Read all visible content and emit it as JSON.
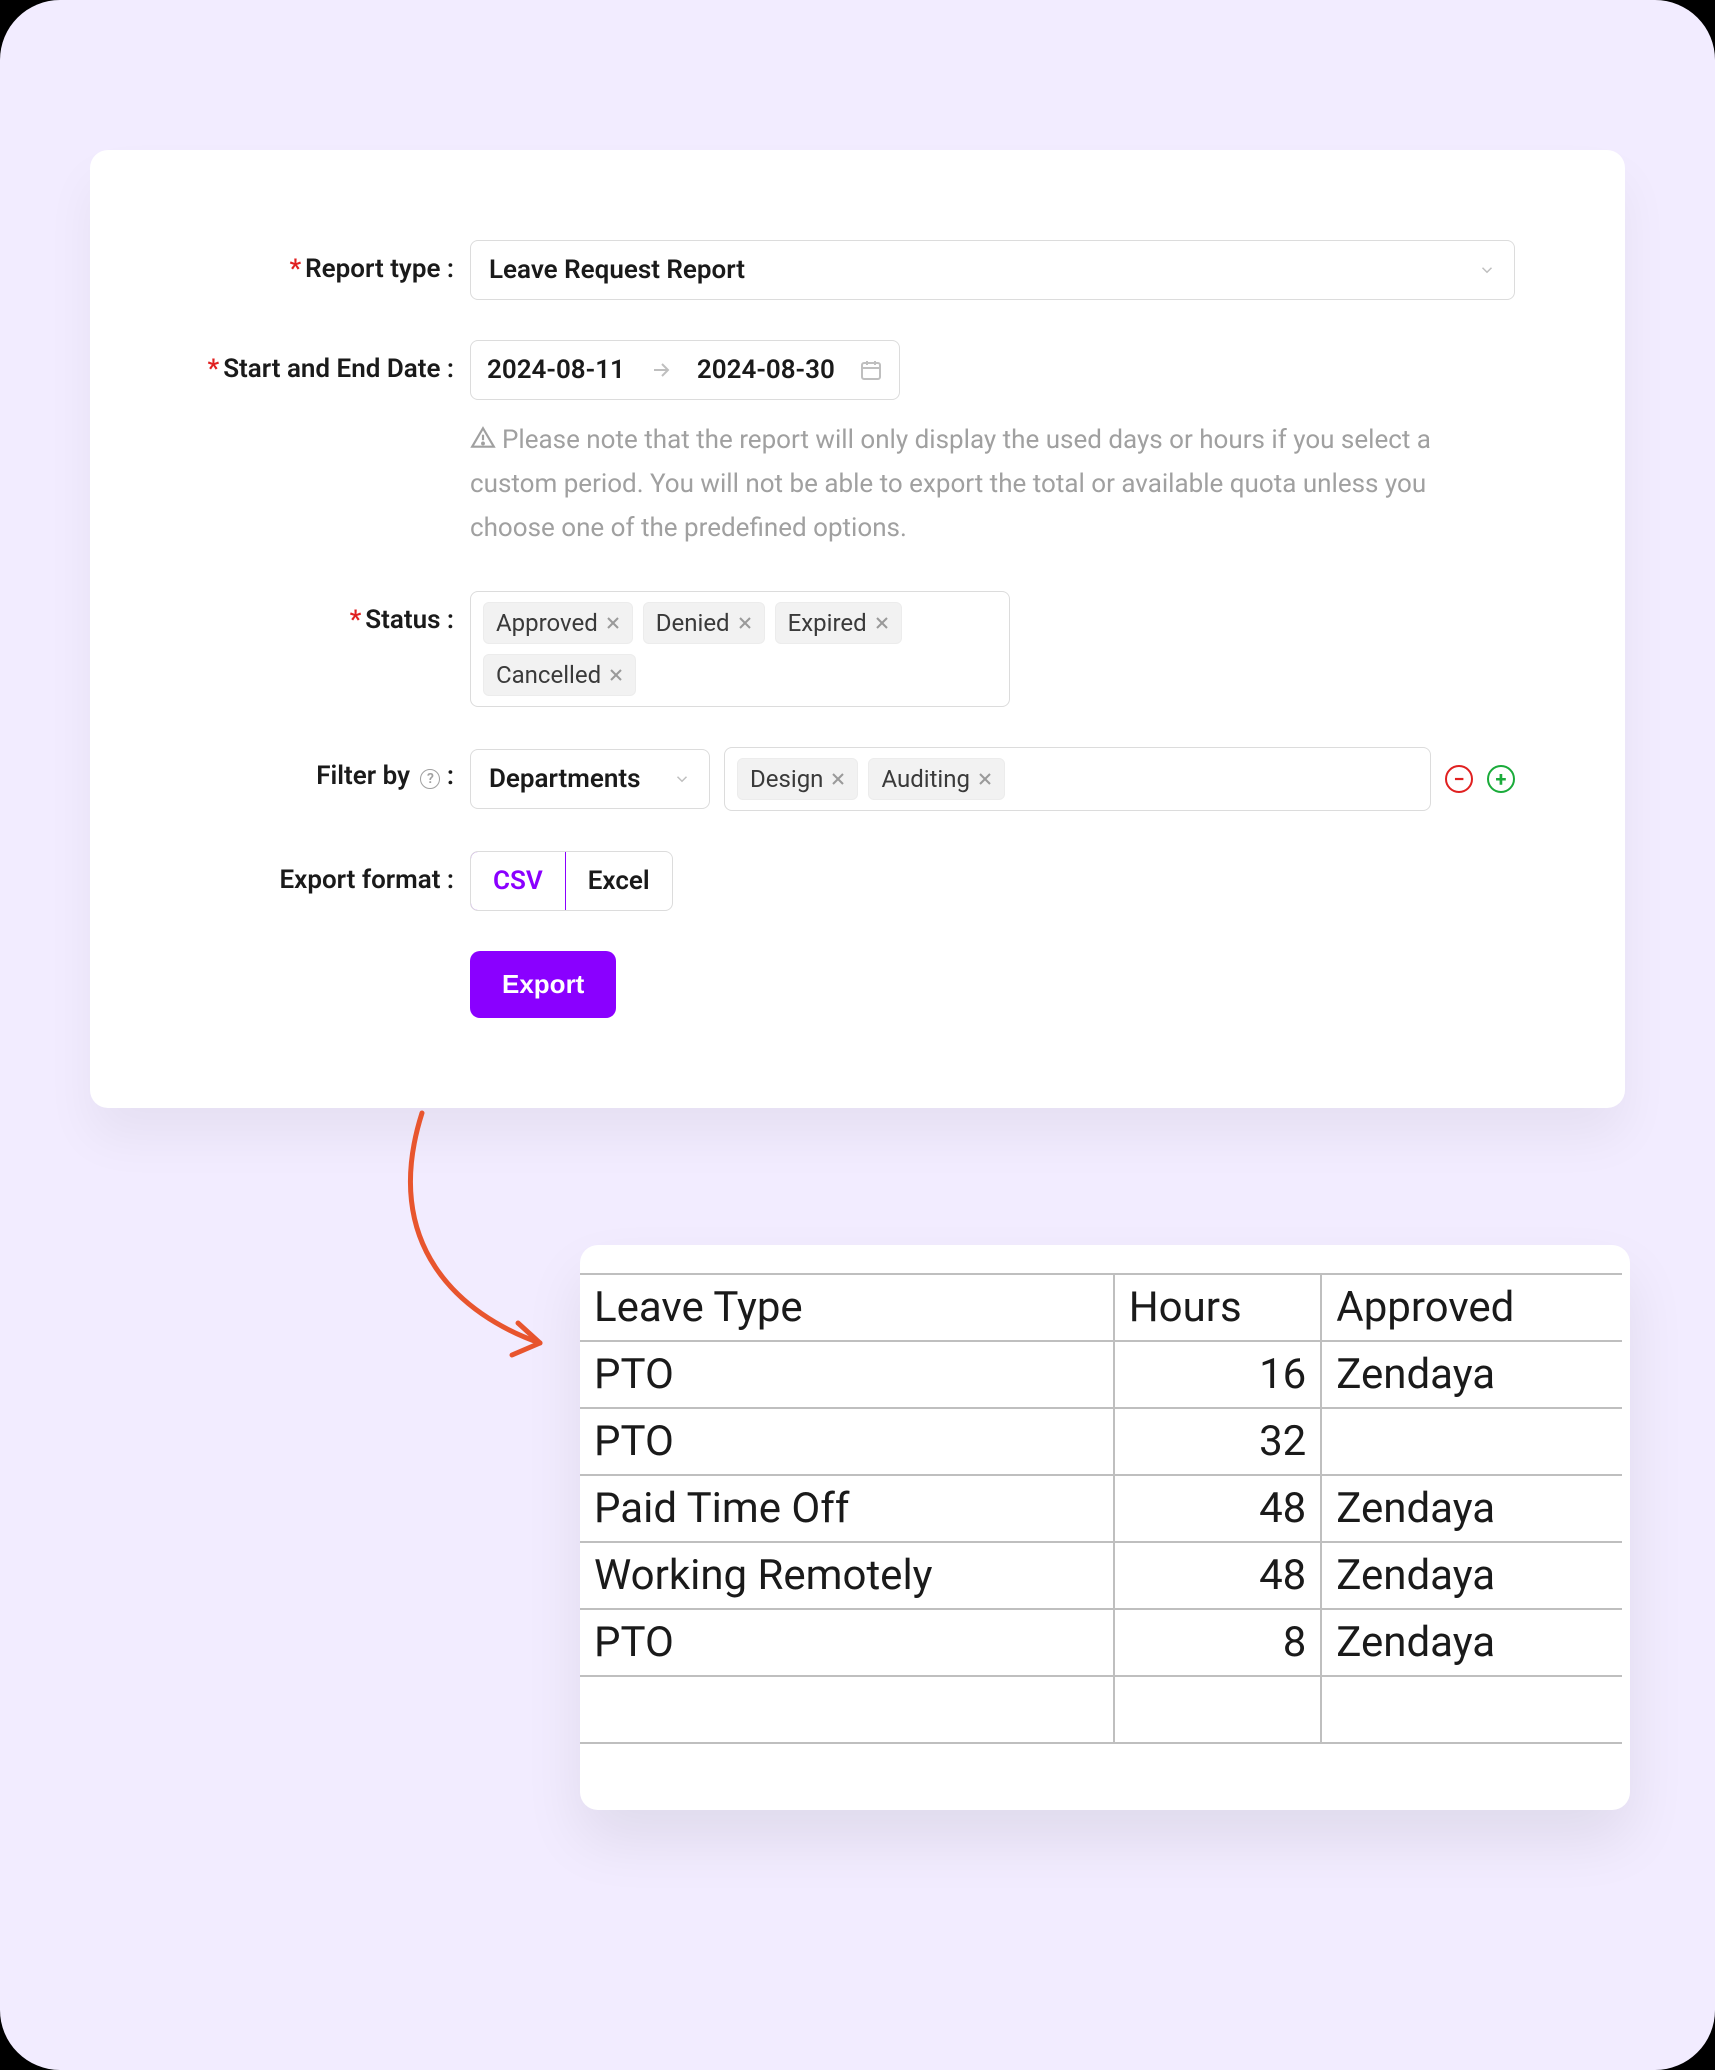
{
  "form": {
    "report_type": {
      "label": "Report type",
      "value": "Leave Request Report",
      "required": true
    },
    "dates": {
      "label": "Start and End Date",
      "start": "2024-08-11",
      "end": "2024-08-30",
      "required": true
    },
    "date_note": "Please note that the report will only display the used days or hours if you select a custom period. You will not be able to export the total or available quota unless you choose one of the predefined options.",
    "status": {
      "label": "Status",
      "required": true,
      "items": [
        "Approved",
        "Denied",
        "Expired",
        "Cancelled"
      ]
    },
    "filter": {
      "label": "Filter by",
      "selector_value": "Departments",
      "tags": [
        "Design",
        "Auditing"
      ]
    },
    "export_format": {
      "label": "Export format",
      "options": [
        "CSV",
        "Excel"
      ],
      "selected": "CSV"
    },
    "export_button": "Export"
  },
  "colors": {
    "accent": "#8a00ff",
    "danger": "#e02020",
    "success": "#1aab3a",
    "surface": "#f2ecff"
  },
  "table": {
    "headers": [
      "Leave Type",
      "Hours",
      "Approved"
    ],
    "rows": [
      [
        "PTO",
        "16",
        "Zendaya"
      ],
      [
        "PTO",
        "32",
        ""
      ],
      [
        "Paid Time Off",
        "48",
        "Zendaya"
      ],
      [
        "Working Remotely",
        "48",
        "Zendaya"
      ],
      [
        "PTO",
        "8",
        "Zendaya"
      ]
    ]
  }
}
